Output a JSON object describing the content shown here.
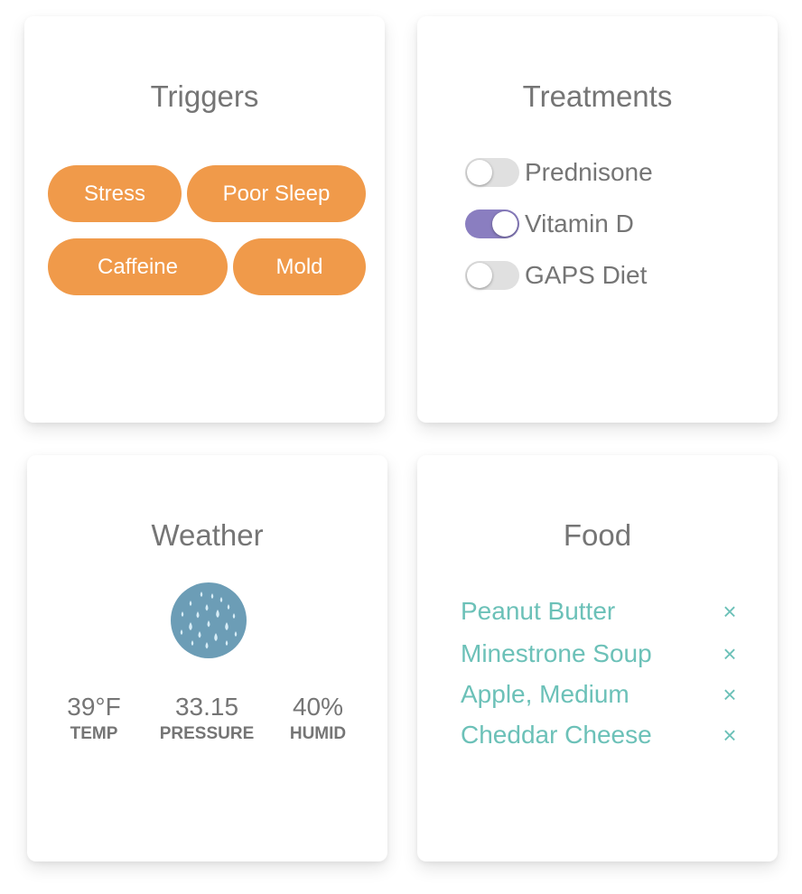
{
  "triggers": {
    "title": "Triggers",
    "items": [
      "Stress",
      "Poor Sleep",
      "Caffeine",
      "Mold"
    ],
    "chip_color": "#f09a4a"
  },
  "treatments": {
    "title": "Treatments",
    "items": [
      {
        "label": "Prednisone",
        "on": false
      },
      {
        "label": "Vitamin D",
        "on": true
      },
      {
        "label": "GAPS Diet",
        "on": false
      }
    ],
    "toggle_on_color": "#8a7ec0"
  },
  "weather": {
    "title": "Weather",
    "icon": "rain-icon",
    "icon_color": "#6c9db6",
    "stats": [
      {
        "value": "39°F",
        "label": "TEMP"
      },
      {
        "value": "33.15",
        "label": "PRESSURE"
      },
      {
        "value": "40%",
        "label": "HUMID"
      }
    ]
  },
  "food": {
    "title": "Food",
    "items": [
      "Peanut Butter",
      "Minestrone Soup",
      "Apple, Medium",
      "Cheddar Cheese"
    ],
    "remove_glyph": "×",
    "text_color": "#6cc1b8"
  }
}
